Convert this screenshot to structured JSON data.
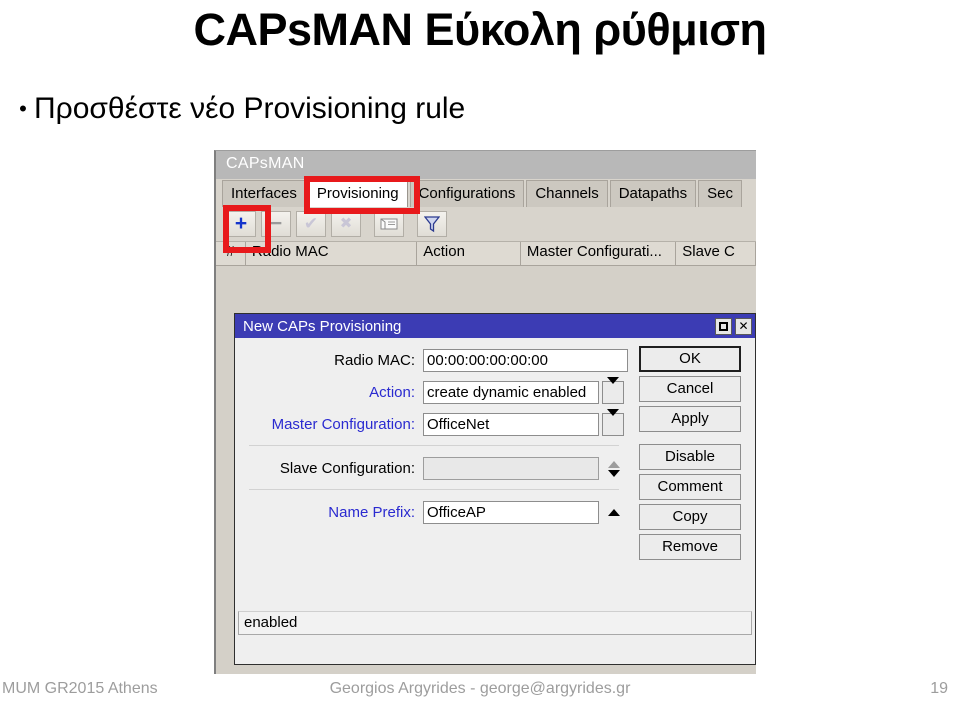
{
  "slide": {
    "title": "CAPsMAN Εύκολη ρύθμιση",
    "bullet_marker": "•",
    "bullet_text": "Προσθέστε νέο Provisioning rule",
    "footer_left": "MUM GR2015 Athens",
    "footer_center": "Georgios Argyrides - george@argyrides.gr",
    "page_number": "19"
  },
  "capsman_window": {
    "title": "CAPsMAN",
    "tabs": [
      {
        "label": "Interfaces",
        "active": false
      },
      {
        "label": "Provisioning",
        "active": true
      },
      {
        "label": "Configurations",
        "active": false
      },
      {
        "label": "Channels",
        "active": false
      },
      {
        "label": "Datapaths",
        "active": false
      },
      {
        "label": "Sec",
        "active": false
      }
    ],
    "toolbar": [
      {
        "icon": "plus-icon",
        "glyph": "+"
      },
      {
        "icon": "minus-icon",
        "glyph": "−"
      },
      {
        "icon": "check-icon",
        "glyph": "✓"
      },
      {
        "icon": "cross-icon",
        "glyph": "✗"
      },
      {
        "icon": "comment-icon",
        "glyph": ""
      },
      {
        "icon": "filter-icon",
        "glyph": ""
      }
    ],
    "columns": [
      "#",
      "Radio MAC",
      "Action",
      "Master Configurati...",
      "Slave C"
    ]
  },
  "dialog": {
    "title": "New CAPs Provisioning",
    "titlebar_color": "#3c3cb4",
    "window_buttons": [
      {
        "name": "maximize-button",
        "glyph": "□"
      },
      {
        "name": "close-button",
        "glyph": "✕"
      }
    ],
    "fields": [
      {
        "label": "Radio MAC:",
        "value": "00:00:00:00:00:00",
        "label_color": "#000000",
        "control": "text"
      },
      {
        "label": "Action:",
        "value": "create dynamic enabled",
        "label_color": "#2a2ad0",
        "control": "dropdown"
      },
      {
        "label": "Master Configuration:",
        "value": "OfficeNet",
        "label_color": "#2a2ad0",
        "control": "dropdown"
      },
      {
        "label": "Slave Configuration:",
        "value": "",
        "label_color": "#000000",
        "control": "spinner"
      },
      {
        "label": "Name Prefix:",
        "value": "OfficeAP",
        "label_color": "#2a2ad0",
        "control": "collapse"
      }
    ],
    "buttons": [
      {
        "label": "OK",
        "default": true
      },
      {
        "label": "Cancel",
        "default": false
      },
      {
        "label": "Apply",
        "default": false
      },
      {
        "label": "Disable",
        "default": false
      },
      {
        "label": "Comment",
        "default": false
      },
      {
        "label": "Copy",
        "default": false
      },
      {
        "label": "Remove",
        "default": false
      }
    ],
    "status_text": "enabled"
  },
  "highlights": {
    "color": "#e8191b",
    "targets": [
      "provisioning-tab",
      "add-button"
    ]
  }
}
